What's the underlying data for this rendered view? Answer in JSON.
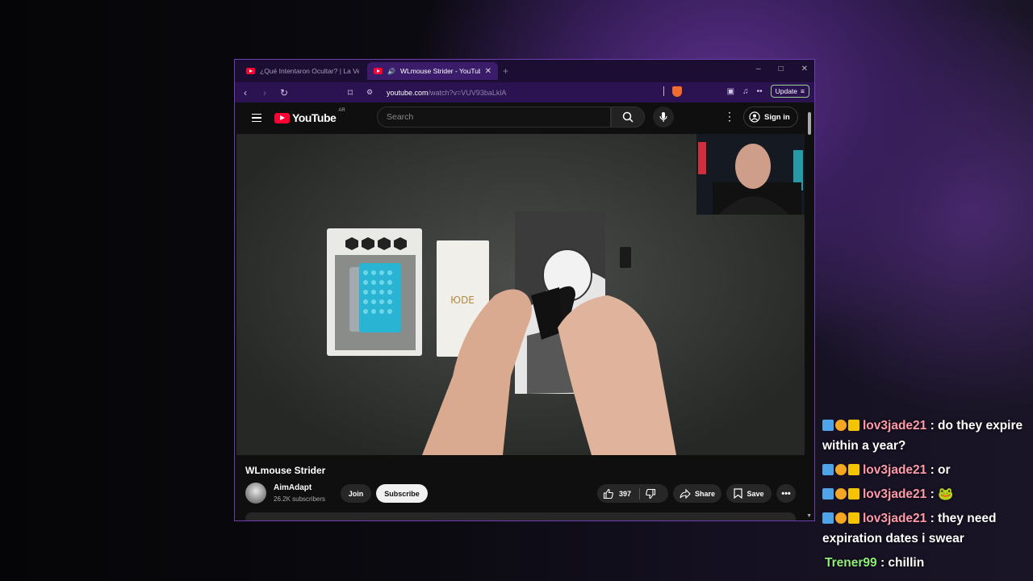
{
  "browser": {
    "tabs": [
      {
        "title": "¿Qué Intentaron Ocultar? | La Verdad",
        "active": false
      },
      {
        "title": "WLmouse Strider - YouTube",
        "active": true
      }
    ],
    "new_tab_glyph": "+",
    "window_controls": {
      "minimize": "–",
      "maximize": "□",
      "close": "✕"
    },
    "url_host": "youtube.com",
    "url_path": "/watch?v=VUV93baLklA",
    "update_label": "Update",
    "accent_color": "#6b3fb0"
  },
  "youtube": {
    "logo_text": "YouTube",
    "country_code": "AR",
    "search_placeholder": "Search",
    "sign_in_label": "Sign in",
    "video_title": "WLmouse Strider",
    "channel": {
      "name": "AimAdapt",
      "subscribers": "26.2K subscribers"
    },
    "join_label": "Join",
    "subscribe_label": "Subscribe",
    "like_count": "397",
    "share_label": "Share",
    "save_label": "Save"
  },
  "chat": {
    "messages": [
      {
        "user": "lov3jade21",
        "text": " : do they expire within a year?"
      },
      {
        "user": "lov3jade21",
        "text": " : or"
      },
      {
        "user": "lov3jade21",
        "text": " : 🐸"
      },
      {
        "user": "lov3jade21",
        "text": " : they need expiration dates i swear"
      },
      {
        "user": "Trener99",
        "text": " : chillin"
      }
    ]
  }
}
